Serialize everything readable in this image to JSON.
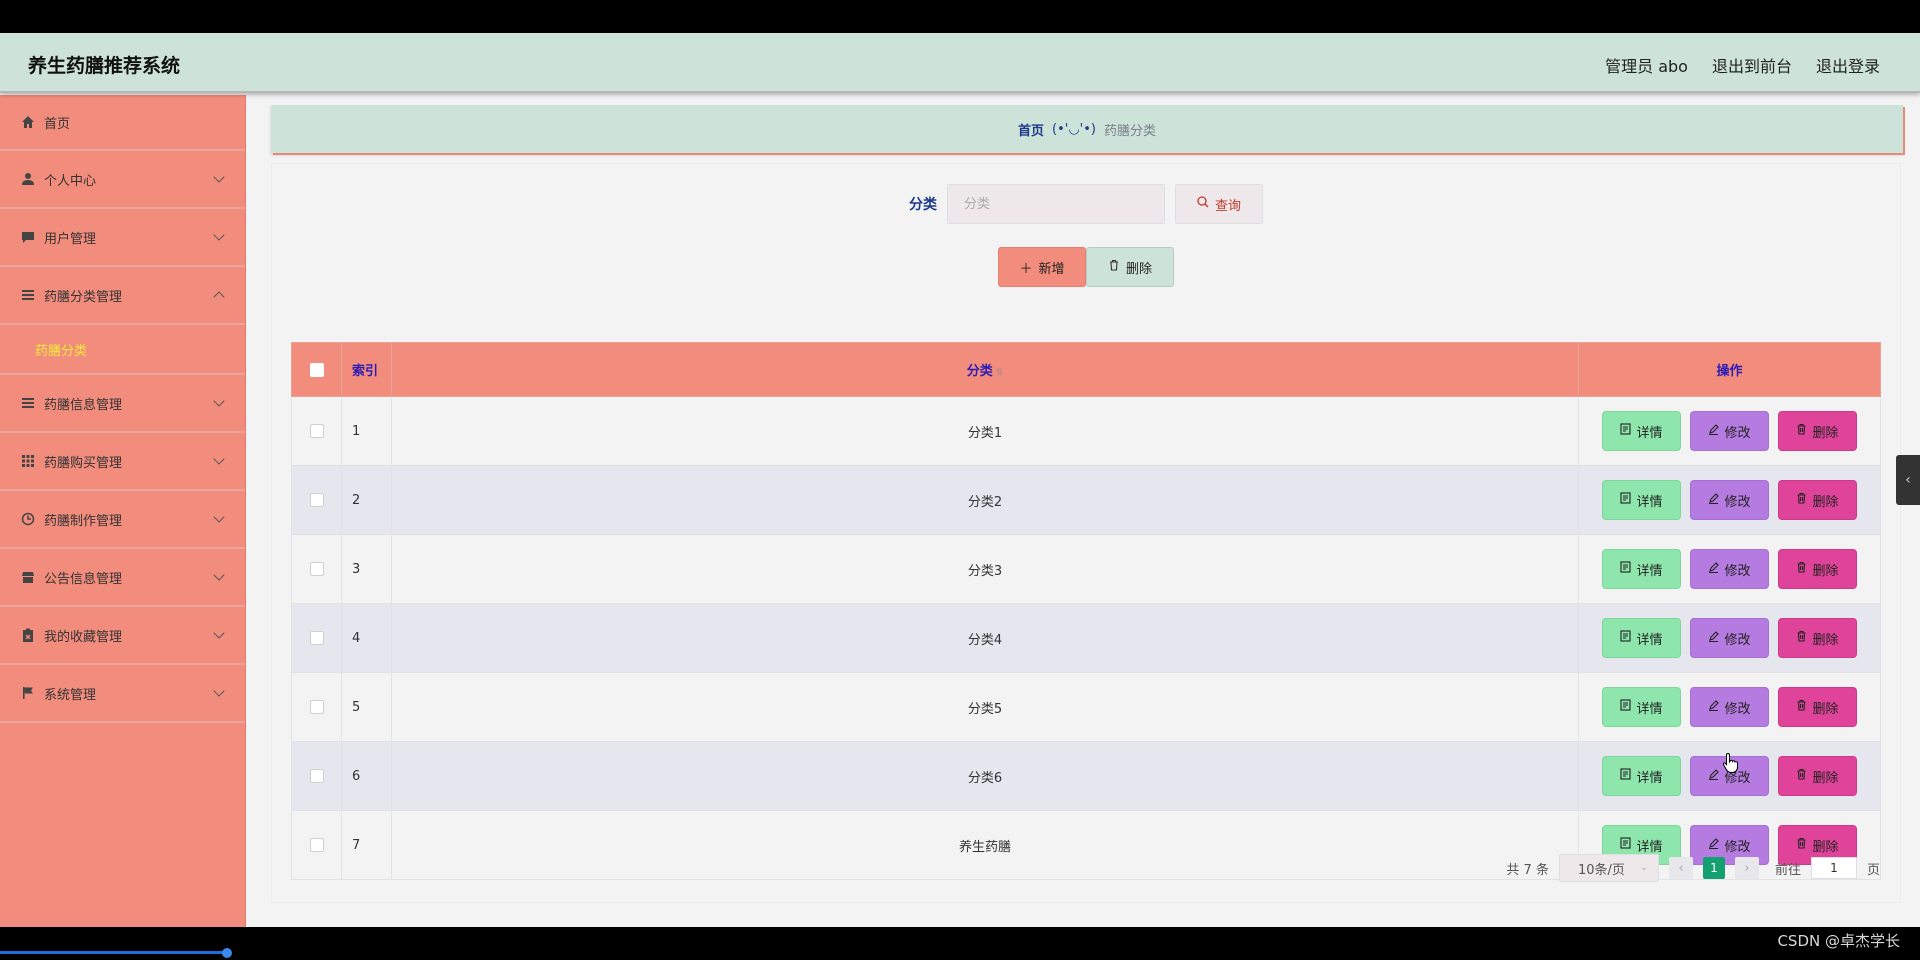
{
  "header": {
    "title": "养生药膳推荐系统",
    "user": "管理员 abo",
    "to_front": "退出到前台",
    "logout": "退出登录"
  },
  "sidebar": {
    "home": "首页",
    "items": [
      {
        "label": "个人中心",
        "icon": "user-icon"
      },
      {
        "label": "用户管理",
        "icon": "chat-icon"
      },
      {
        "label": "药膳分类管理",
        "icon": "list-icon",
        "expanded": true
      },
      {
        "label": "药膳信息管理",
        "icon": "list-icon"
      },
      {
        "label": "药膳购买管理",
        "icon": "grid-icon"
      },
      {
        "label": "药膳制作管理",
        "icon": "clock-icon"
      },
      {
        "label": "公告信息管理",
        "icon": "store-icon"
      },
      {
        "label": "我的收藏管理",
        "icon": "clipboard-icon"
      },
      {
        "label": "系统管理",
        "icon": "flag-icon"
      }
    ],
    "sub_item": "药膳分类"
  },
  "breadcrumb": {
    "home": "首页",
    "separator": "(•'◡'•)",
    "current": "药膳分类"
  },
  "search": {
    "label": "分类",
    "placeholder": "分类",
    "button": "查询"
  },
  "actions": {
    "add": "新增",
    "delete": "删除"
  },
  "table": {
    "headers": {
      "index": "索引",
      "category": "分类",
      "ops": "操作"
    },
    "rows": [
      {
        "index": "1",
        "category": "分类1"
      },
      {
        "index": "2",
        "category": "分类2"
      },
      {
        "index": "3",
        "category": "分类3"
      },
      {
        "index": "4",
        "category": "分类4"
      },
      {
        "index": "5",
        "category": "分类5"
      },
      {
        "index": "6",
        "category": "分类6"
      },
      {
        "index": "7",
        "category": "养生药膳"
      }
    ],
    "op_labels": {
      "detail": "详情",
      "edit": "修改",
      "remove": "删除"
    }
  },
  "pagination": {
    "total": "共 7 条",
    "page_size": "10条/页",
    "current_page": "1",
    "goto_prefix": "前往",
    "goto_value": "1",
    "goto_suffix": "页"
  },
  "watermark": "CSDN @卓杰学长",
  "colors": {
    "header_bg": "#cde2d8",
    "sidebar_bg": "#f28c7c",
    "active_sub": "#f4ec3a",
    "detail_btn": "#8ee6ad",
    "edit_btn": "#b57be0",
    "remove_btn": "#e0449a",
    "page_active": "#14a071"
  }
}
